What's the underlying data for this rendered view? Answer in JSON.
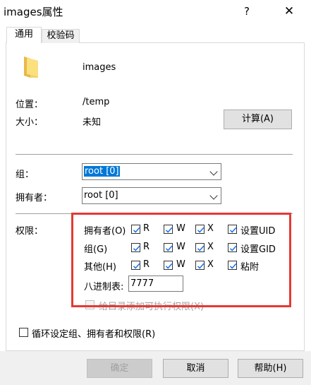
{
  "window": {
    "title": "images属性",
    "help_glyph": "?",
    "close_glyph": "✕"
  },
  "tabs": [
    {
      "label": "通用",
      "active": true
    },
    {
      "label": "校验码",
      "active": false
    }
  ],
  "file": {
    "name": "images",
    "icon": "folder-icon"
  },
  "info": {
    "location_label": "位置：",
    "location_value": "/temp",
    "size_label": "大小：",
    "size_value": "未知",
    "compute_button": "计算(A)"
  },
  "ownership": {
    "group_label": "组：",
    "group_value": "root [0]",
    "owner_label": "拥有者：",
    "owner_value": "root [0]"
  },
  "permissions": {
    "label": "权限：",
    "rows": [
      {
        "name": "拥有者(O)",
        "r": {
          "label": "R",
          "checked": true
        },
        "w": {
          "label": "W",
          "checked": true
        },
        "x": {
          "label": "X",
          "checked": true
        },
        "extra": {
          "label": "设置UID",
          "checked": true
        }
      },
      {
        "name": "组(G)",
        "r": {
          "label": "R",
          "checked": true
        },
        "w": {
          "label": "W",
          "checked": true
        },
        "x": {
          "label": "X",
          "checked": true
        },
        "extra": {
          "label": "设置GID",
          "checked": true
        }
      },
      {
        "name": "其他(H)",
        "r": {
          "label": "R",
          "checked": true
        },
        "w": {
          "label": "W",
          "checked": true
        },
        "x": {
          "label": "X",
          "checked": true
        },
        "extra": {
          "label": "粘附",
          "checked": true
        }
      }
    ],
    "octal_label": "八进制表:",
    "octal_value": "7777",
    "dir_exec_label": "给目录添加可执行权限(X)",
    "dir_exec_enabled": false
  },
  "recursive": {
    "label": "循环设定组、拥有者和权限(R)",
    "checked": false
  },
  "buttons": {
    "ok": "确定",
    "ok_enabled": false,
    "cancel": "取消",
    "help": "帮助(H)"
  },
  "colors": {
    "highlight": "#e53935",
    "selection": "#0078d7",
    "check": "#1a73e8"
  }
}
